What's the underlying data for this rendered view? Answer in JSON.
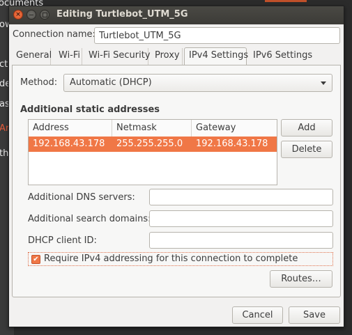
{
  "background": {
    "lines": [
      "ocuments",
      "ow",
      "ctu",
      "de",
      "as",
      "Arl",
      "the"
    ]
  },
  "window": {
    "title": "Editing Turtlebot_UTM_5G",
    "close_glyph": "×"
  },
  "connection": {
    "name_label": "Connection name:",
    "name_value": "Turtlebot_UTM_5G"
  },
  "tabs": [
    {
      "label": "General"
    },
    {
      "label": "Wi-Fi"
    },
    {
      "label": "Wi-Fi Security"
    },
    {
      "label": "Proxy"
    },
    {
      "label": "IPv4 Settings"
    },
    {
      "label": "IPv6 Settings"
    }
  ],
  "ipv4": {
    "method_label": "Method:",
    "method_value": "Automatic (DHCP)",
    "static_title": "Additional static addresses",
    "columns": [
      "Address",
      "Netmask",
      "Gateway"
    ],
    "rows": [
      {
        "address": "192.168.43.178",
        "netmask": "255.255.255.0",
        "gateway": "192.168.43.178"
      }
    ],
    "add_label": "Add",
    "delete_label": "Delete",
    "dns_label": "Additional DNS servers:",
    "dns_value": "",
    "search_label": "Additional search domains:",
    "search_value": "",
    "dhcp_label": "DHCP client ID:",
    "dhcp_value": "",
    "require_label": "Require IPv4 addressing for this connection to complete",
    "require_checked": true,
    "check_glyph": "✔",
    "routes_label": "Routes…"
  },
  "footer": {
    "cancel_label": "Cancel",
    "save_label": "Save"
  },
  "colors": {
    "accent": "#f07746",
    "dialog_bg": "#f2f1f0",
    "titlebar": "#3c3b37"
  }
}
